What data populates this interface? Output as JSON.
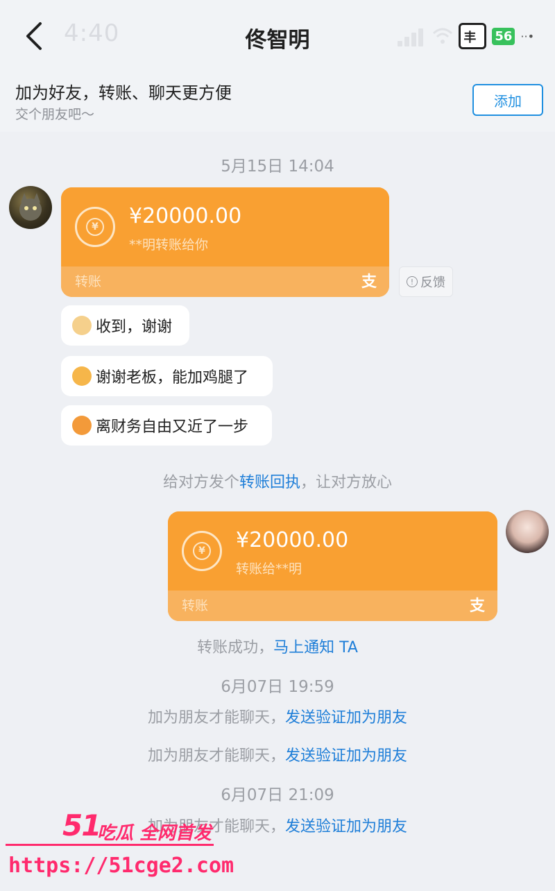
{
  "header": {
    "faint_time": "4:40",
    "title": "佟智明",
    "status_net": "56",
    "status_badge": "丰",
    "status_more": "··•"
  },
  "banner": {
    "title": "加为好友，转账、聊天更方便",
    "subtitle": "交个朋友吧～",
    "add_label": "添加"
  },
  "messages": {
    "time1": "5月15日 14:04",
    "transfer_in": {
      "amount": "¥20000.00",
      "note": "**明转账给你",
      "label": "转账",
      "pay_icon": "支"
    },
    "feedback": "反馈",
    "reply1": "收到，谢谢",
    "reply2": "谢谢老板，能加鸡腿了",
    "reply3": "离财务自由又近了一步",
    "receipt_prefix": "给对方发个",
    "receipt_link": "转账回执",
    "receipt_suffix": "，让对方放心",
    "transfer_out": {
      "amount": "¥20000.00",
      "note": "转账给**明",
      "label": "转账",
      "pay_icon": "支"
    },
    "success_prefix": "转账成功，",
    "success_link": "马上通知 TA",
    "time2": "6月07日 19:59",
    "friend_prefix": "加为朋友才能聊天，",
    "friend_link": "发送验证加为朋友",
    "time3": "6月07日 21:09"
  },
  "watermark": {
    "number": "51",
    "tag": "吃瓜 全网首发",
    "url": "https://51cge2.com"
  },
  "colors": {
    "accent_blue": "#1e7ed8",
    "transfer_orange": "#f9a032",
    "watermark_pink": "#ff2a6d"
  }
}
